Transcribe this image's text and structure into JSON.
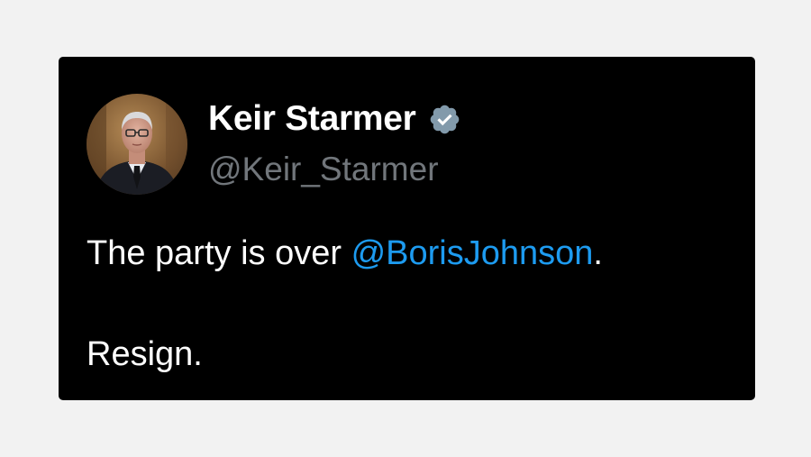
{
  "tweet": {
    "author": {
      "display_name": "Keir Starmer",
      "handle": "@Keir_Starmer",
      "verified": true,
      "verified_icon": "verified-badge-icon",
      "verified_color": "#829aab"
    },
    "text": {
      "line1_prefix": "The party is over ",
      "mention": "@BorisJohnson",
      "line1_suffix": ".",
      "line2": "Resign."
    }
  },
  "colors": {
    "card_background": "#000000",
    "page_background": "#f2f2f2",
    "text_primary": "#ffffff",
    "text_secondary": "#71767b",
    "link": "#1d9bf0"
  }
}
